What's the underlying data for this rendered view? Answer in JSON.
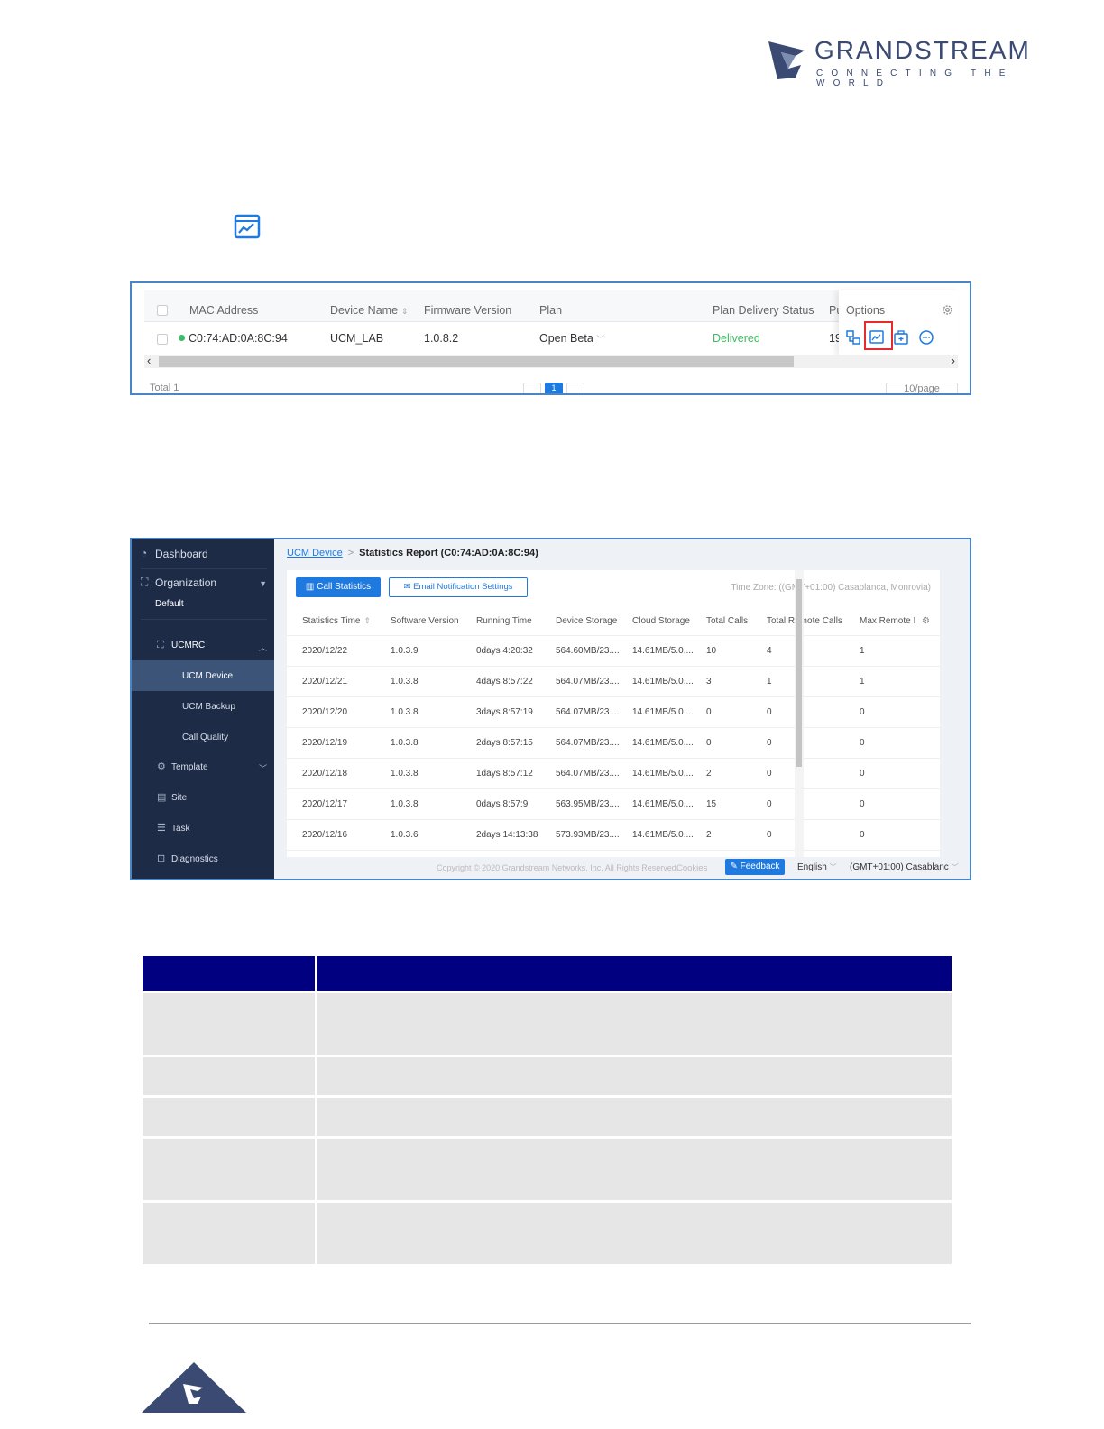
{
  "brand": {
    "name": "GRANDSTREAM",
    "tagline": "CONNECTING THE WORLD",
    "colors": {
      "navy": "#3a4a73",
      "accent": "#1f7ae0",
      "table_header": "#000080"
    }
  },
  "inline_icon": "statistics-chart-icon",
  "device_table": {
    "columns": [
      "MAC Address",
      "Device Name",
      "Firmware Version",
      "Plan",
      "Plan Delivery Status",
      "Pu",
      "Options"
    ],
    "row": {
      "mac": "C0:74:AD:0A:8C:94",
      "device_name": "UCM_LAB",
      "firmware": "1.0.8.2",
      "plan": "Open Beta",
      "delivery_status": "Delivered",
      "pu": "19"
    },
    "footer_total": "Total 1",
    "current_page": "1",
    "page_size": "10/page"
  },
  "stats_report": {
    "sidebar": {
      "dashboard": "Dashboard",
      "organization": "Organization",
      "organization_value": "Default",
      "ucmrc": "UCMRC",
      "ucm_device": "UCM Device",
      "ucm_backup": "UCM Backup",
      "call_quality": "Call Quality",
      "template": "Template",
      "site": "Site",
      "task": "Task",
      "diagnostics": "Diagnostics"
    },
    "breadcrumb": {
      "parent": "UCM Device",
      "current": "Statistics Report (C0:74:AD:0A:8C:94)"
    },
    "buttons": {
      "call_statistics": "Call Statistics",
      "email_settings": "Email Notification Settings"
    },
    "time_zone": "Time Zone: ((GMT+01:00) Casablanca, Monrovia)",
    "columns": [
      "Statistics Time",
      "Software Version",
      "Running Time",
      "Device Storage",
      "Cloud Storage",
      "Total Calls",
      "Total Remote Calls",
      "Max Remote !"
    ],
    "rows": [
      [
        "2020/12/22",
        "1.0.3.9",
        "0days 4:20:32",
        "564.60MB/23....",
        "14.61MB/5.0....",
        "10",
        "4",
        "1"
      ],
      [
        "2020/12/21",
        "1.0.3.8",
        "4days 8:57:22",
        "564.07MB/23....",
        "14.61MB/5.0....",
        "3",
        "1",
        "1"
      ],
      [
        "2020/12/20",
        "1.0.3.8",
        "3days 8:57:19",
        "564.07MB/23....",
        "14.61MB/5.0....",
        "0",
        "0",
        "0"
      ],
      [
        "2020/12/19",
        "1.0.3.8",
        "2days 8:57:15",
        "564.07MB/23....",
        "14.61MB/5.0....",
        "0",
        "0",
        "0"
      ],
      [
        "2020/12/18",
        "1.0.3.8",
        "1days 8:57:12",
        "564.07MB/23....",
        "14.61MB/5.0....",
        "2",
        "0",
        "0"
      ],
      [
        "2020/12/17",
        "1.0.3.8",
        "0days 8:57:9",
        "563.95MB/23....",
        "14.61MB/5.0....",
        "15",
        "0",
        "0"
      ],
      [
        "2020/12/16",
        "1.0.3.6",
        "2days 14:13:38",
        "573.93MB/23....",
        "14.61MB/5.0....",
        "2",
        "0",
        "0"
      ]
    ],
    "footer": {
      "copyright": "Copyright © 2020 Grandstream Networks, Inc. All Rights Reserved.",
      "cookies": "Cookies",
      "feedback": "Feedback",
      "language": "English",
      "timezone": "(GMT+01:00) Casablanc"
    }
  }
}
